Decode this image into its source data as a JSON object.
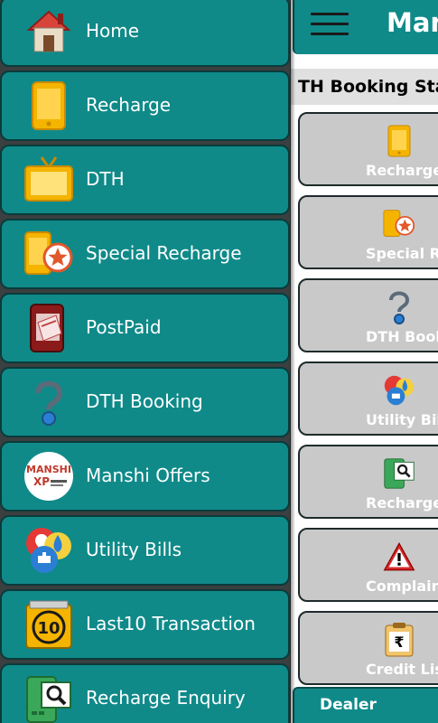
{
  "app": {
    "title": "Mansh",
    "marquee": "TH Booking Star",
    "bottom_bar_label": "Dealer"
  },
  "tiles": [
    {
      "label": "Recharge",
      "icon": "phone-icon"
    },
    {
      "label": "Special Recha",
      "icon": "special-recharge-icon"
    },
    {
      "label": "DTH Bookin",
      "icon": "dth-booking-icon"
    },
    {
      "label": "Utility Bills",
      "icon": "utility-bills-icon"
    },
    {
      "label": "Recharge Enq",
      "icon": "recharge-enquiry-icon"
    },
    {
      "label": "Complaint",
      "icon": "warning-icon"
    },
    {
      "label": "Credit List",
      "icon": "credit-list-icon"
    }
  ],
  "drawer": {
    "items": [
      {
        "label": "Home",
        "icon": "house-icon"
      },
      {
        "label": "Recharge",
        "icon": "phone-icon"
      },
      {
        "label": "DTH",
        "icon": "tv-icon"
      },
      {
        "label": "Special Recharge",
        "icon": "special-recharge-icon"
      },
      {
        "label": "PostPaid",
        "icon": "postpaid-icon"
      },
      {
        "label": "DTH Booking",
        "icon": "dth-booking-icon"
      },
      {
        "label": "Manshi Offers",
        "icon": "manshi-xp-logo-icon"
      },
      {
        "label": "Utility Bills",
        "icon": "utility-bills-icon"
      },
      {
        "label": "Last10 Transaction",
        "icon": "last10-icon"
      },
      {
        "label": "Recharge Enquiry",
        "icon": "recharge-enquiry-icon"
      }
    ]
  },
  "logo_text": {
    "line1": "MANSHI",
    "line2": "XP"
  },
  "last10_badge": "10",
  "colors": {
    "accent": "#0f8a89",
    "tile_bg": "#c9c9c9",
    "drawer_bg": "#3a3f3f"
  }
}
